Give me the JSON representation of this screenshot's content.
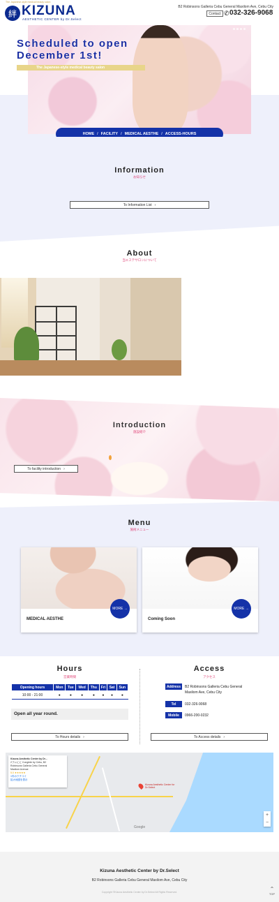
{
  "header": {
    "tagline": "The Japanese-style medical beauty salon",
    "logo_mark": "絆",
    "logo_text": "KIZUNA",
    "logo_sub": "AESTHETIC CENTER by Dr.Select",
    "address": "B2 Robinsons Galleria Cebu General Maxilom Ave, Cebu City",
    "contact_label": "Contact",
    "phone": "032-326-9068"
  },
  "hero": {
    "title_line1": "Scheduled to open",
    "title_line2": "December 1st!",
    "subtitle": "The Japanese-style medical beauty salon"
  },
  "nav": {
    "items": [
      "HOME",
      "FACILITY",
      "MEDICAL AESTHE",
      "ACCESS-HOURS"
    ]
  },
  "information": {
    "title": "Information",
    "subtitle": "お知らせ",
    "button_label": "To Information List"
  },
  "about": {
    "title": "About",
    "subtitle": "当エステサロンについて"
  },
  "introduction": {
    "title": "Introduction",
    "subtitle": "施設紹介",
    "button_label": "To facility introduction"
  },
  "menu": {
    "title": "Menu",
    "subtitle": "施術メニュー",
    "cards": [
      {
        "title": "MEDICAL AESTHE",
        "more_label": "MORE →"
      },
      {
        "title": "Coming Soon",
        "more_label": "MORE →"
      }
    ]
  },
  "hours": {
    "title": "Hours",
    "subtitle": "営業時間",
    "table_head": [
      "Opening hours",
      "Mon",
      "Tue",
      "Wed",
      "Thu",
      "Fri",
      "Sat",
      "Sun"
    ],
    "row": [
      "10:00 - 21:00",
      "●",
      "●",
      "●",
      "●",
      "●",
      "●",
      "●"
    ],
    "note": "Open all year round.",
    "button_label": "To Hours details"
  },
  "access": {
    "title": "Access",
    "subtitle": "アクセス",
    "address_label": "Address",
    "address_value": "B2 Robinsons Galleria Cebu General Maxilom Ave, Cebu City",
    "tel_label": "Tel",
    "tel_value": "032-326-9068",
    "mobile_label": "Mobile",
    "mobile_value": "0966-200-0232",
    "button_label": "To Access details"
  },
  "map": {
    "card_title": "Kizuna Aesthetic Center by Dr...",
    "card_line1": "2フレにに Conglete by Cebu, B2",
    "card_line2": "Robinsons Galleria Cebu General",
    "card_line3": "Maxilom Avenue",
    "rating": "5.0 ★★★★★",
    "reviews": "1件のクチコミ",
    "link_label": "拡大地図を表示",
    "pin_label": "Kizuna Aesthetic Center for Dr.Select",
    "zoom_in": "+",
    "zoom_out": "−",
    "google_label": "Google"
  },
  "footer": {
    "name": "Kizuna Aesthetic Center by Dr.Select",
    "address": "B2 Robinsons Galleria Cebu General Maxilom Ave, Cebu City",
    "copyright": "Copyright ©Kizuna Aesthetic Center by Dr.Select All Rights Reserved.",
    "top_label": "TOP"
  },
  "colors": {
    "brand_blue": "#1432a8",
    "accent_pink": "#e0487a",
    "accent_gold": "#e8d58a",
    "section_bg": "#eef0fb"
  }
}
